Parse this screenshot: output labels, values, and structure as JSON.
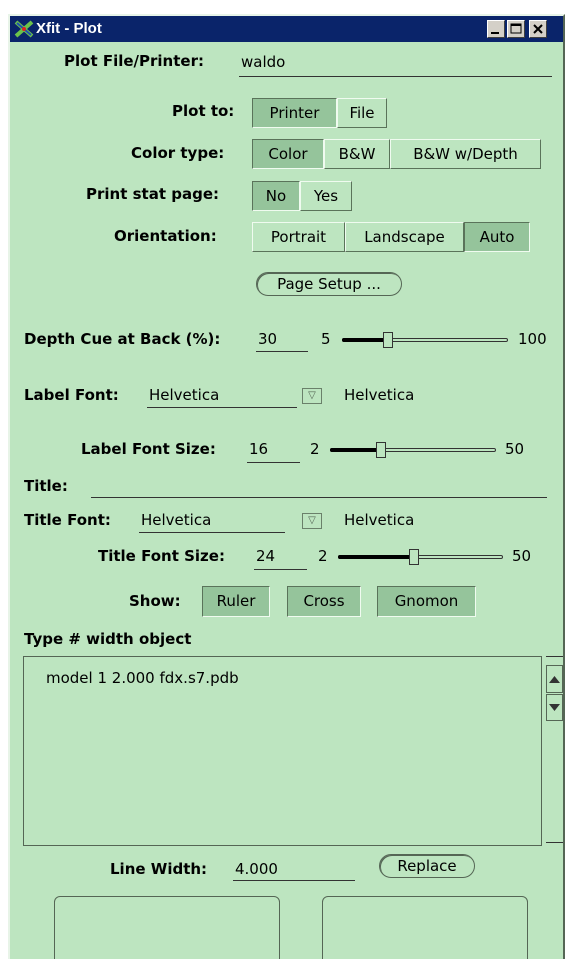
{
  "window": {
    "title": "Xfit - Plot"
  },
  "plot_file": {
    "label": "Plot File/Printer:",
    "value": "waldo"
  },
  "plot_to": {
    "label": "Plot to:",
    "options": [
      "Printer",
      "File"
    ],
    "selected": "Printer"
  },
  "color_type": {
    "label": "Color type:",
    "options": [
      "Color",
      "B&W",
      "B&W w/Depth"
    ],
    "selected": "Color"
  },
  "stat_page": {
    "label": "Print stat page:",
    "options": [
      "No",
      "Yes"
    ],
    "selected": "No"
  },
  "orientation": {
    "label": "Orientation:",
    "options": [
      "Portrait",
      "Landscape",
      "Auto"
    ],
    "selected": "Auto"
  },
  "page_setup": {
    "label": "Page Setup ..."
  },
  "depth_cue": {
    "label": "Depth Cue at Back (%):",
    "value": "30",
    "min": "5",
    "max": "100",
    "level": 30
  },
  "label_font": {
    "label": "Label Font:",
    "value": "Helvetica",
    "display": "Helvetica"
  },
  "label_font_size": {
    "label": "Label Font Size:",
    "value": "16",
    "min": "2",
    "max": "50",
    "level": 16
  },
  "title": {
    "label": "Title:",
    "value": ""
  },
  "title_font": {
    "label": "Title Font:",
    "value": "Helvetica",
    "display": "Helvetica"
  },
  "title_font_size": {
    "label": "Title Font Size:",
    "value": "24",
    "min": "2",
    "max": "50",
    "level": 24
  },
  "show": {
    "label": "Show:",
    "options": [
      "Ruler",
      "Cross",
      "Gnomon"
    ]
  },
  "objects": {
    "label": "Type # width object",
    "rows": [
      "model 1 2.000 fdx.s7.pdb"
    ]
  },
  "line_width": {
    "label": "Line Width:",
    "value": "4.000",
    "button": "Replace"
  },
  "colors": {
    "background": "#bde5c0",
    "selected": "#95c49b",
    "titlebar": "#0a246a"
  }
}
